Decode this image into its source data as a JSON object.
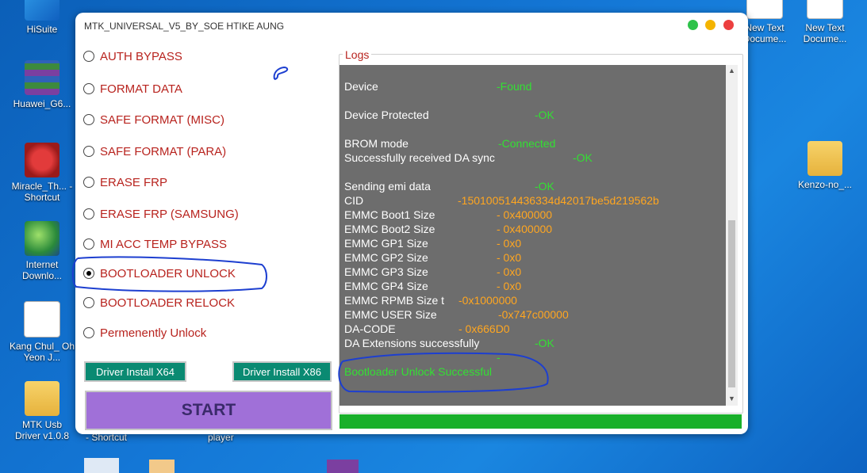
{
  "desktop": {
    "icons": [
      {
        "id": "hisuite",
        "label": "HiSuite"
      },
      {
        "id": "huawei",
        "label": "Huawei_G6..."
      },
      {
        "id": "miracle",
        "label": "Miracle_Th... - Shortcut"
      },
      {
        "id": "idm",
        "label": "Internet Downlo..."
      },
      {
        "id": "kang",
        "label": "Kang Chul_ Oh Yeon J..."
      },
      {
        "id": "mtkusb",
        "label": "MTK Usb Driver v1.0.8"
      },
      {
        "id": "newtext1",
        "label": "New Text Docume..."
      },
      {
        "id": "newtext2",
        "label": "New Text Docume..."
      },
      {
        "id": "kenzo",
        "label": "Kenzo-no_..."
      }
    ],
    "partial_labels": {
      "shortcut": "- Shortcut",
      "player": "player"
    }
  },
  "window": {
    "title": "MTK_UNIVERSAL_V5_BY_SOE HTIKE AUNG",
    "options": [
      {
        "label": "AUTH BYPASS",
        "selected": false
      },
      {
        "label": "FORMAT DATA",
        "selected": false
      },
      {
        "label": "SAFE FORMAT (MISC)",
        "selected": false
      },
      {
        "label": "SAFE FORMAT (PARA)",
        "selected": false
      },
      {
        "label": "ERASE FRP",
        "selected": false
      },
      {
        "label": "ERASE FRP (SAMSUNG)",
        "selected": false
      },
      {
        "label": "MI ACC TEMP BYPASS",
        "selected": false
      },
      {
        "label": "BOOTLOADER UNLOCK",
        "selected": true
      },
      {
        "label": "BOOTLOADER RELOCK",
        "selected": false
      },
      {
        "label": "Permenently Unlock",
        "selected": false
      }
    ],
    "buttons": {
      "driver_x64": "Driver Install X64",
      "driver_x86": "Driver Install X86",
      "start": "START"
    },
    "logs": {
      "legend": "Logs",
      "lines": [
        {
          "key": "Device",
          "value": "-Found",
          "color": "green"
        },
        {
          "key": "Device Protected",
          "value": "-OK",
          "color": "green"
        },
        {
          "key": "BROM mode",
          "value": "-Connected",
          "color": "green"
        },
        {
          "key": "Successfully received DA sync",
          "value": "-OK",
          "color": "green"
        },
        {
          "key": "Sending emi data",
          "value": "-OK",
          "color": "green"
        },
        {
          "key": "CID",
          "value": "-150100514436334d42017be5d219562b",
          "color": "orange"
        },
        {
          "key": "EMMC Boot1 Size",
          "value": "- 0x400000",
          "color": "orange"
        },
        {
          "key": "EMMC Boot2 Size",
          "value": "- 0x400000",
          "color": "orange"
        },
        {
          "key": "EMMC GP1 Size",
          "value": "- 0x0",
          "color": "orange"
        },
        {
          "key": "EMMC GP2 Size",
          "value": "- 0x0",
          "color": "orange"
        },
        {
          "key": "EMMC GP3 Size",
          "value": "- 0x0",
          "color": "orange"
        },
        {
          "key": "EMMC GP4 Size",
          "value": "- 0x0",
          "color": "orange"
        },
        {
          "key": "EMMC RPMB Size t",
          "value": "-0x1000000",
          "color": "orange"
        },
        {
          "key": "EMMC USER Size",
          "value": "-0x747c00000",
          "color": "orange"
        },
        {
          "key": "DA-CODE",
          "value": "- 0x666D0",
          "color": "orange"
        },
        {
          "key": "DA Extensions successfully",
          "value": "-OK",
          "color": "green"
        },
        {
          "key": "",
          "value": "-",
          "color": "green"
        },
        {
          "key": "Bootloader Unlock Successful",
          "value": "",
          "color": "green"
        }
      ]
    },
    "progress": 1.0
  },
  "colors": {
    "option_text": "#b8231e",
    "log_green": "#33e033",
    "log_orange": "#ffa620",
    "driver_button": "#0a8a72",
    "start_button": "#a070d8",
    "progress_fill": "#19b02a"
  }
}
